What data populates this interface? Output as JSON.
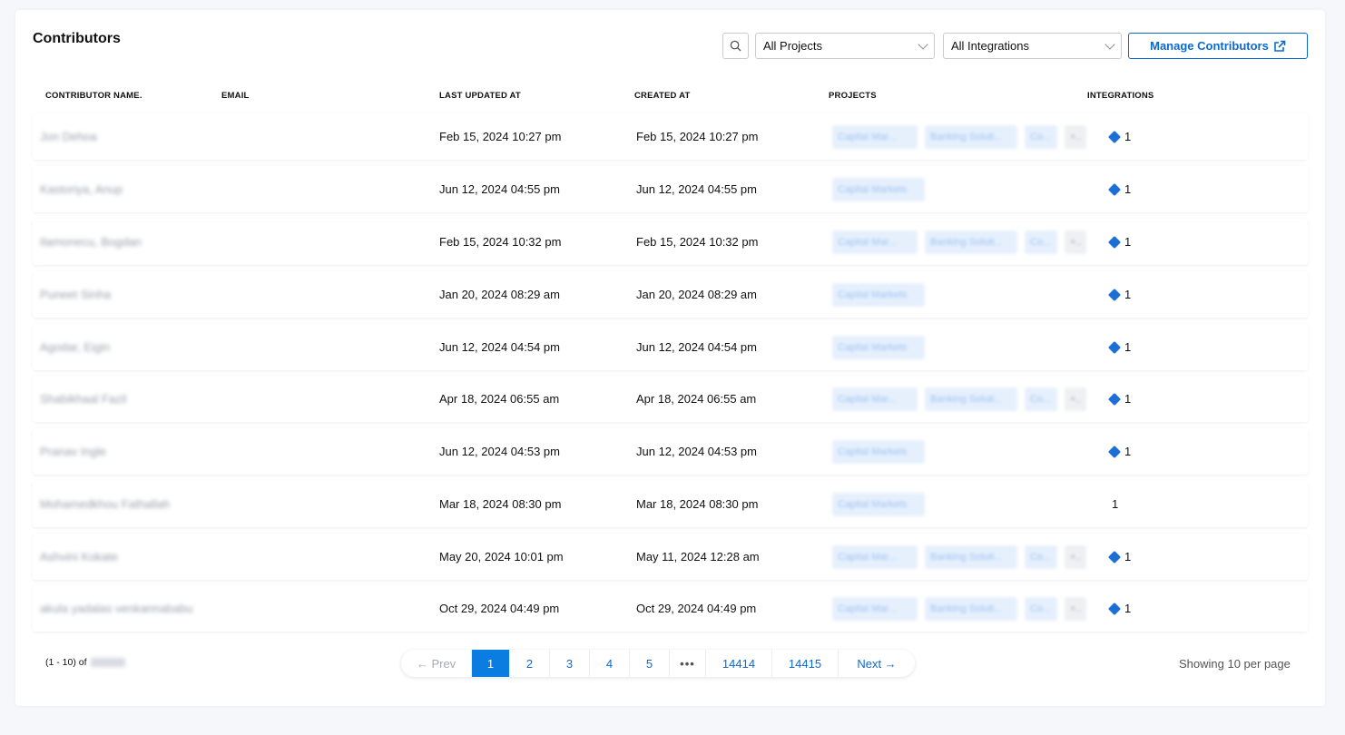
{
  "header": {
    "title": "Contributors",
    "projects_filter": "All Projects",
    "integrations_filter": "All Integrations",
    "manage_label": "Manage Contributors"
  },
  "columns": [
    "CONTRIBUTOR NAME.",
    "EMAIL",
    "LAST UPDATED AT",
    "CREATED AT",
    "PROJECTS",
    "INTEGRATIONS"
  ],
  "rows": [
    {
      "updated": "Feb 15, 2024 10:27 pm",
      "created": "Feb 15, 2024 10:27 pm",
      "integrations": "1"
    },
    {
      "updated": "Jun 12, 2024 04:55 pm",
      "created": "Jun 12, 2024 04:55 pm",
      "integrations": "1"
    },
    {
      "updated": "Feb 15, 2024 10:32 pm",
      "created": "Feb 15, 2024 10:32 pm",
      "integrations": "1"
    },
    {
      "updated": "Jan 20, 2024 08:29 am",
      "created": "Jan 20, 2024 08:29 am",
      "integrations": "1"
    },
    {
      "updated": "Jun 12, 2024 04:54 pm",
      "created": "Jun 12, 2024 04:54 pm",
      "integrations": "1"
    },
    {
      "updated": "Apr 18, 2024 06:55 am",
      "created": "Apr 18, 2024 06:55 am",
      "integrations": "1"
    },
    {
      "updated": "Jun 12, 2024 04:53 pm",
      "created": "Jun 12, 2024 04:53 pm",
      "integrations": "1"
    },
    {
      "updated": "Mar 18, 2024 08:30 pm",
      "created": "Mar 18, 2024 08:30 pm",
      "integrations": "1"
    },
    {
      "updated": "May 20, 2024 10:01 pm",
      "created": "May 11, 2024 12:28 am",
      "integrations": "1"
    },
    {
      "updated": "Oct 29, 2024 04:49 pm",
      "created": "Oct 29, 2024 04:49 pm",
      "integrations": "1"
    }
  ],
  "footer": {
    "count_prefix": "(1 - 10) of",
    "pagination": {
      "prev": "← Prev",
      "pages": [
        "1",
        "2",
        "3",
        "4",
        "5"
      ],
      "ellipsis": "•••",
      "last_pages": [
        "14414",
        "14415"
      ],
      "next": "Next →"
    },
    "per_page": "Showing 10 per page"
  },
  "colors": {
    "accent": "#0b6ad0",
    "active_page": "#0b7ce0",
    "jira_icon": "#1c6fd6"
  }
}
